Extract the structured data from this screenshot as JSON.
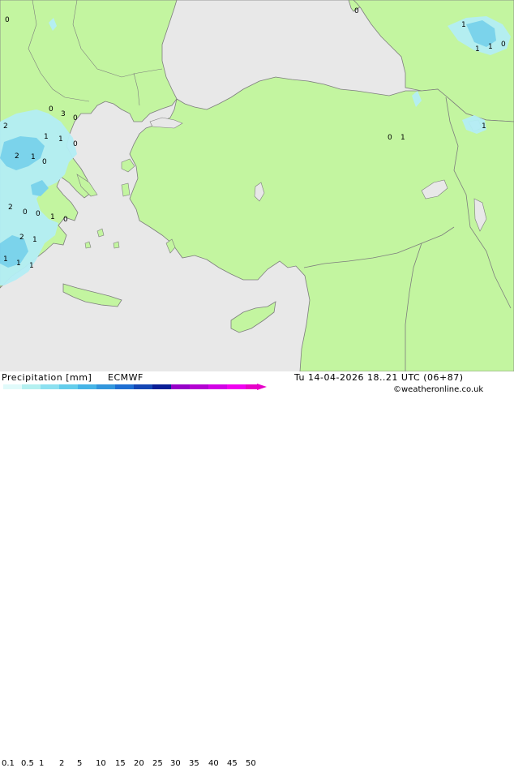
{
  "legend": {
    "title": "Precipitation [mm]",
    "model": "ECMWF",
    "datetime": "Tu 14-04-2026 18..21 UTC (06+87)",
    "credit": "©weatheronline.co.uk",
    "scale_labels": [
      "0.1",
      "0.5",
      "1",
      "2",
      "5",
      "10",
      "15",
      "20",
      "25",
      "30",
      "35",
      "40",
      "45",
      "50"
    ],
    "scale_colors": [
      "#e0fafa",
      "#b4f0f0",
      "#8ce0f0",
      "#64cdeb",
      "#46b4e6",
      "#3296dc",
      "#1e6ed2",
      "#1446b4",
      "#0a1e96",
      "#9600c8",
      "#b400d2",
      "#d200e6",
      "#f000f0",
      "#e600c8"
    ]
  },
  "map": {
    "colors": {
      "sea": "#e8e8e8",
      "land": "#c3f5a0",
      "coast": "#7d7d7d",
      "precip_light": "#b4eef5",
      "precip_medium": "#78d2f0",
      "precip_heavy": "#46b4e6"
    },
    "point_values": [
      "0",
      "1",
      "1",
      "1",
      "0",
      "2",
      "1",
      "0",
      "1",
      "1",
      "2",
      "0",
      "0",
      "1",
      "2",
      "1",
      "1",
      "3",
      "0",
      "0",
      "0",
      "2",
      "1",
      "1",
      "0",
      "1",
      "0",
      "1"
    ]
  }
}
